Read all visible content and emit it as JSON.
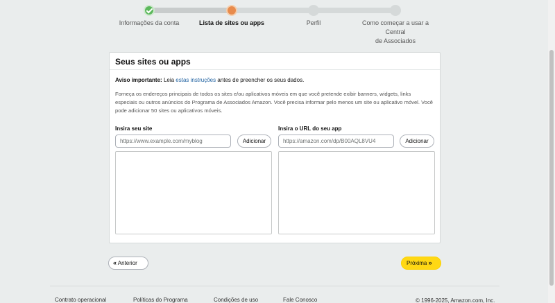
{
  "stepper": {
    "steps": [
      {
        "label": "Informações da conta",
        "state": "done"
      },
      {
        "label": "Lista de sites ou apps",
        "state": "current"
      },
      {
        "label": "Perfil",
        "state": "pending"
      },
      {
        "label": "Como começar a usar a Central\nde Associados",
        "state": "pending"
      }
    ]
  },
  "card": {
    "title": "Seus sites ou apps",
    "notice_strong": "Aviso importante:",
    "notice_pre": " Leia ",
    "notice_link": "estas instruções",
    "notice_post": " antes de preencher os seus dados.",
    "description": "Forneça os endereços principais de todos os sites e/ou aplicativos móveis em que você pretende exibir banners, widgets, links especiais ou outros anúncios do Programa de Associados Amazon. Você precisa informar pelo menos um site ou aplicativo móvel. Você pode adicionar 50 sites ou aplicativos móveis.",
    "site": {
      "label": "Insira seu site",
      "placeholder": "https://www.example.com/myblog",
      "add_label": "Adicionar"
    },
    "app": {
      "label": "Insira o URL do seu app",
      "placeholder": "https://amazon.com/dp/B00AQL8VU4",
      "add_label": "Adicionar"
    }
  },
  "nav": {
    "prev_label": "Anterior",
    "next_label": "Próxima"
  },
  "footer": {
    "links": [
      "Contrato operacional",
      "Políticas do Programa",
      "Condições de uso",
      "Fale Conosco"
    ],
    "copyright": "© 1996-2025, Amazon.com, Inc."
  },
  "colors": {
    "accent_next": "#ffd814",
    "done": "#5cb85c",
    "current": "#e88b4c",
    "link": "#2162a1"
  }
}
